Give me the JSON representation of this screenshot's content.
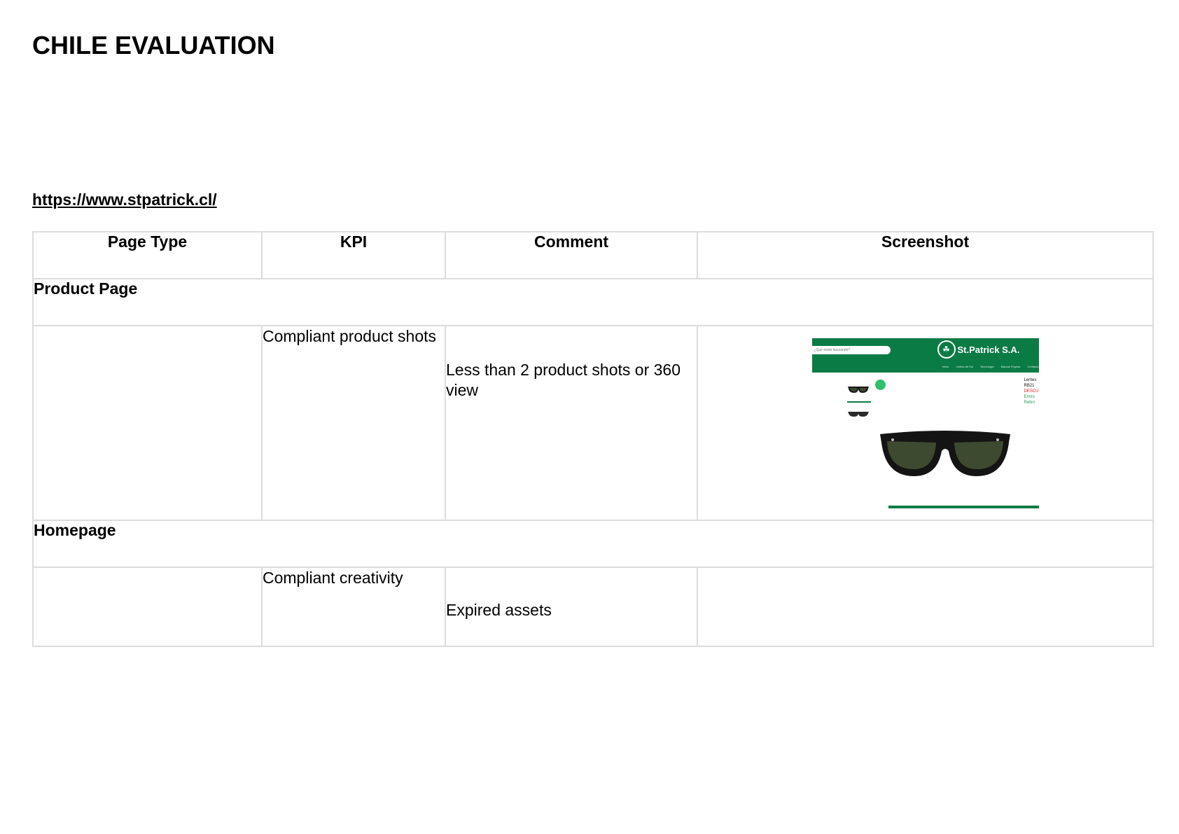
{
  "document": {
    "title": "CHILE EVALUATION",
    "site_url": "https://www.stpatrick.cl/"
  },
  "table": {
    "headers": [
      "Page Type",
      "KPI",
      "Comment",
      "Screenshot"
    ],
    "sections": [
      {
        "name": "Product Page",
        "row": {
          "page_type": "",
          "kpi": "Compliant product shots",
          "comment": "Less than 2 product shots or 360 view"
        }
      },
      {
        "name": "Homepage",
        "row": {
          "page_type": "",
          "kpi": "Compliant creativity",
          "comment": "Expired assets"
        }
      }
    ]
  },
  "screenshot_mock": {
    "brand": "St.Patrick S.A.",
    "search_placeholder": "¿Qué estás buscando?",
    "nav_items": [
      "Inicio",
      "Lentes de Sol",
      "Tecnología",
      "Marcas Propias",
      "Contacto"
    ],
    "side_lines": [
      "Lentes",
      "RB21",
      "DESCUENTO",
      "Envío",
      "Retiro"
    ],
    "colors": {
      "header": "#0b7b45",
      "badge": "#2fbf6a"
    },
    "icons": [
      "sunglasses-thumbnail-icon",
      "sunglasses-product-image",
      "brand-logo-icon"
    ]
  }
}
